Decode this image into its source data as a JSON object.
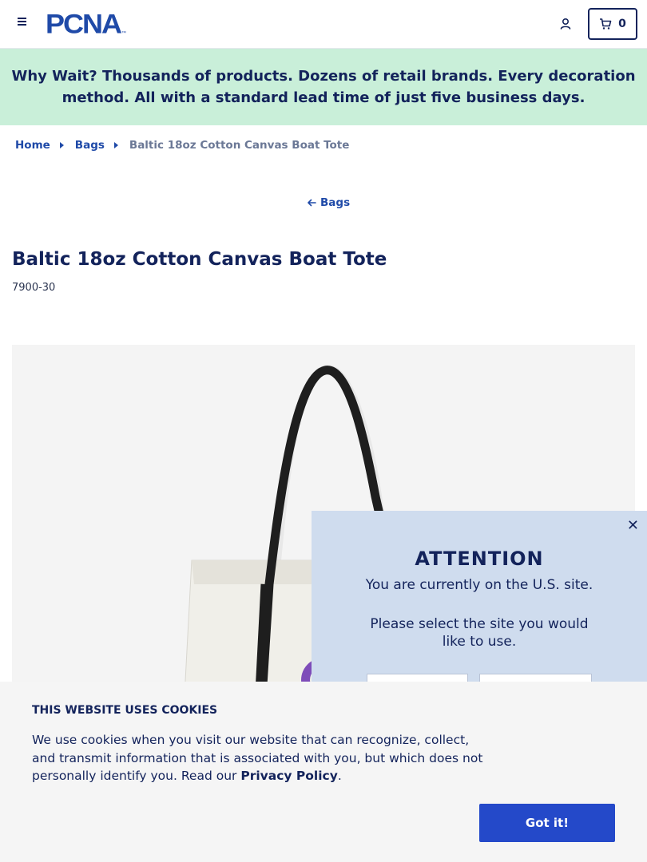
{
  "header": {
    "logo_text": "PCNA",
    "logo_tm": "™",
    "cart_count": "0",
    "icons": {
      "menu": "hamburger-menu-icon",
      "account": "user-account-icon",
      "cart": "shopping-cart-icon"
    }
  },
  "promo": {
    "lead": "Why Wait?",
    "text": " Thousands of products. Dozens of retail brands. Every decoration method. All with a standard lead time of just five business days."
  },
  "breadcrumb": {
    "items": [
      "Home",
      "Bags"
    ],
    "current": "Baltic 18oz Cotton Canvas Boat Tote"
  },
  "back_link": {
    "label": "Bags",
    "icon": "arrow-left-icon"
  },
  "product": {
    "title": "Baltic 18oz Cotton Canvas Boat Tote",
    "sku": "7900-30"
  },
  "attention": {
    "title": "ATTENTION",
    "line1": "You are currently on the U.S. site.",
    "line2": "Please select the site you would like to use.",
    "close": "✕"
  },
  "cookie": {
    "title": "THIS WEBSITE USES COOKIES",
    "text": "We use cookies when you visit our website that can recognize, collect, and transmit information that is associated with you, but which does not personally identify you. Read our ",
    "link": "Privacy Policy",
    "end": ".",
    "button": "Got it!"
  },
  "colors": {
    "navy": "#13235b",
    "brand_blue": "#1f4aa8",
    "promo_bg": "#c9efd9",
    "modal_bg": "#cfdcee",
    "button_blue": "#2449c9"
  }
}
